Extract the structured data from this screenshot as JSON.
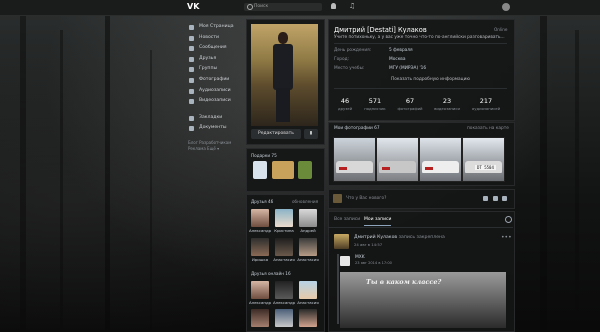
{
  "topbar": {
    "search_placeholder": "Поиск"
  },
  "sidebar": {
    "items": [
      {
        "label": "Моя Страница",
        "icon": "home-icon"
      },
      {
        "label": "Новости",
        "icon": "news-icon"
      },
      {
        "label": "Сообщения",
        "icon": "messages-icon"
      },
      {
        "label": "Друзья",
        "icon": "friends-icon"
      },
      {
        "label": "Группы",
        "icon": "groups-icon"
      },
      {
        "label": "Фотографии",
        "icon": "photos-icon"
      },
      {
        "label": "Аудиозаписи",
        "icon": "music-icon"
      },
      {
        "label": "Видеозаписи",
        "icon": "video-icon"
      },
      {
        "label": "Закладки",
        "icon": "star-icon"
      },
      {
        "label": "Документы",
        "icon": "docs-icon"
      }
    ],
    "links": [
      "Блог",
      "Разработчикам",
      "Реклама",
      "Ещё ▾"
    ]
  },
  "profile": {
    "edit_button": "Редактировать",
    "name": "Дмитрий [Destati] Кулаков",
    "status": "Учите потихоньку, а у вас уже точно что-то по-английски разговаривать...",
    "online": "Online",
    "info": [
      {
        "k": "День рождения:",
        "v": "5 февраля"
      },
      {
        "k": "Город:",
        "v": "Москва"
      },
      {
        "k": "Место учебы:",
        "v": "МГУ (МИРЭА) '16"
      }
    ],
    "more_info": "Показать подробную информацию",
    "stats": [
      {
        "n": "46",
        "l": "друзей"
      },
      {
        "n": "571",
        "l": "подписчик"
      },
      {
        "n": "67",
        "l": "фотографий"
      },
      {
        "n": "23",
        "l": "видеозаписи"
      },
      {
        "n": "217",
        "l": "аудиозаписей"
      }
    ]
  },
  "photos": {
    "title": "Мои фотографии 67",
    "link": "показать на карте",
    "plate": "DT 5504"
  },
  "gifts": {
    "title": "Подарки 75"
  },
  "friends": {
    "title": "Друзья 46",
    "updates": "обновления",
    "row1": [
      "Александр",
      "Кристина",
      "Андрей"
    ],
    "row2": [
      "Иришка",
      "Анастасия",
      "Анастасия"
    ],
    "online_title": "Друзья онлайн 16",
    "row3": [
      "Александр",
      "Александр",
      "Анастасия"
    ],
    "row4": [
      "",
      "",
      ""
    ]
  },
  "composer": {
    "placeholder": "Что у Вас нового?"
  },
  "wall": {
    "tab_all": "Все записи",
    "tab_mine": "Мои записи",
    "post_author": "Дмитрий Кулаков",
    "post_pin": "запись закреплена",
    "post_date": "24 авг в 14:57",
    "repost_name": "MXK",
    "repost_date": "23 авг 2014 в 17:00",
    "image_caption": "Ты в каком классе?"
  }
}
